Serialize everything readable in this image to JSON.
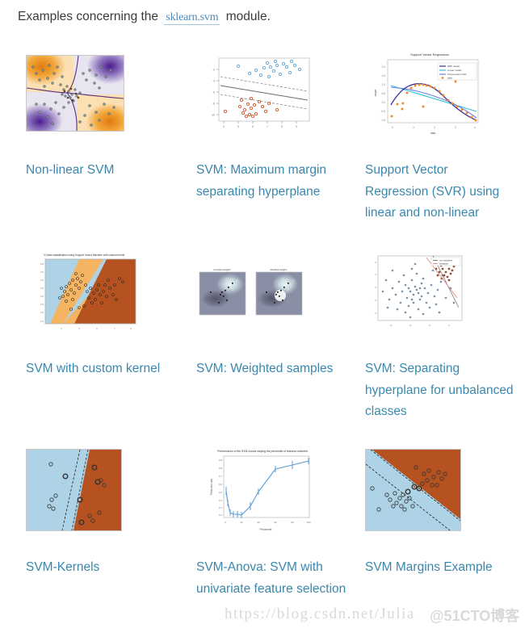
{
  "intro": {
    "before": "Examples concerning the",
    "module": "sklearn.svm",
    "after": "module."
  },
  "gallery": {
    "rows": [
      [
        {
          "caption": "Non-linear SVM",
          "thumb_name": "thumb-non-linear-svm",
          "thumb_kind": "decision-surface"
        },
        {
          "caption": "SVM: Maximum margin separating hyperplane",
          "thumb_name": "thumb-max-margin-hyperplane",
          "thumb_kind": "scatter-with-margins"
        },
        {
          "caption": "Support Vector Regression (SVR) using linear and non-linear kernels",
          "thumb_name": "thumb-support-vector-regression",
          "thumb_kind": "line-chart"
        }
      ],
      [
        {
          "caption": "SVM with custom kernel",
          "thumb_name": "thumb-svm-custom-kernel",
          "thumb_kind": "decision-regions"
        },
        {
          "caption": "SVM: Weighted samples",
          "thumb_name": "thumb-svm-weighted-samples",
          "thumb_kind": "dual-contour"
        },
        {
          "caption": "SVM: Separating hyperplane for unbalanced classes",
          "thumb_name": "thumb-svm-unbalanced-classes",
          "thumb_kind": "scatter-cluster"
        }
      ],
      [
        {
          "caption": "SVM-Kernels",
          "thumb_name": "thumb-svm-kernels",
          "thumb_kind": "decision-regions"
        },
        {
          "caption": "SVM-Anova: SVM with univariate feature selection",
          "thumb_name": "thumb-svm-anova",
          "thumb_kind": "line-chart"
        },
        {
          "caption": "SVM Margins Example",
          "thumb_name": "thumb-svm-margins-example",
          "thumb_kind": "decision-regions"
        }
      ]
    ]
  },
  "thumbnails": {
    "svr": {
      "title": "Support Vector Regression",
      "xlabel": "data",
      "ylabel": "target",
      "legend": [
        "RBF model",
        "Linear model",
        "Polynomial model",
        "data"
      ],
      "xticks": [
        "0",
        "1",
        "2",
        "3",
        "4"
      ],
      "yticks": [
        "-1.5",
        "-1.0",
        "-0.5",
        "0.0",
        "0.5",
        "1.0",
        "1.5",
        "2.0"
      ]
    },
    "custom_kernel": {
      "title": "3-Class classification using Support Vector Machine with custom kernel",
      "xticks": [
        "4",
        "5",
        "6",
        "7",
        "8"
      ],
      "yticks": [
        "2.0",
        "2.5",
        "3.0",
        "3.5",
        "4.0",
        "4.5",
        "5.0"
      ]
    },
    "weighted_samples": {
      "panel_titles": [
        "Constant weights",
        "Modified weights"
      ]
    },
    "unbalanced": {
      "legend": [
        "non weighted",
        "weighted"
      ],
      "xticks": [
        "-4",
        "-2",
        "0",
        "2"
      ],
      "yticks": [
        "-4",
        "-2",
        "0",
        "2",
        "4"
      ]
    },
    "anova": {
      "title": "Performance of the SVM-Anova varying the percentile of features selected",
      "xlabel": "Percentile",
      "ylabel": "Prediction rate",
      "xticks": [
        "0",
        "20",
        "40",
        "60",
        "80",
        "100"
      ],
      "yticks": [
        "0.2",
        "0.3",
        "0.4",
        "0.5",
        "0.6",
        "0.7",
        "0.8",
        "0.9"
      ]
    },
    "max_margin": {
      "xticks": [
        "4",
        "5",
        "6",
        "7",
        "8",
        "9",
        "10"
      ],
      "yticks": [
        "-2",
        "-4",
        "-6",
        "-8",
        "-10"
      ]
    }
  },
  "chart_data": [
    {
      "type": "line",
      "name": "support-vector-regression",
      "title": "Support Vector Regression",
      "xlabel": "data",
      "ylabel": "target",
      "xlim": [
        0,
        4.6
      ],
      "ylim": [
        -1.6,
        2.2
      ],
      "legend_position": "top-right",
      "grid": false,
      "series": [
        {
          "name": "RBF model",
          "color": "#4b3f9e",
          "x": [
            0.0,
            0.5,
            1.0,
            1.5,
            2.0,
            2.5,
            3.0,
            3.5,
            4.0,
            4.5
          ],
          "values": [
            -0.6,
            0.25,
            0.82,
            1.0,
            0.97,
            0.72,
            0.3,
            -0.25,
            -0.85,
            -1.4
          ]
        },
        {
          "name": "Linear model",
          "color": "#2ec5d9",
          "x": [
            0.0,
            4.5
          ],
          "values": [
            1.0,
            -0.75
          ]
        },
        {
          "name": "Polynomial model",
          "color": "#6a7fe0",
          "x": [
            0.0,
            1.0,
            2.0,
            3.0,
            4.0,
            4.5
          ],
          "values": [
            0.92,
            0.88,
            0.72,
            0.34,
            -0.35,
            -1.2
          ]
        },
        {
          "name": "data",
          "color": "#f08a2c",
          "x": [
            0.05,
            0.3,
            0.55,
            0.8,
            1.05,
            1.3,
            1.55,
            1.8,
            2.05,
            2.3,
            2.55,
            2.8,
            3.05,
            3.3,
            3.55,
            3.8,
            4.05,
            4.4
          ],
          "values": [
            -1.25,
            0.25,
            0.3,
            0.85,
            0.9,
            0.95,
            1.0,
            2.05,
            0.95,
            0.75,
            1.15,
            0.35,
            0.1,
            -0.3,
            -0.55,
            -0.75,
            -1.1,
            -1.45
          ]
        }
      ]
    },
    {
      "type": "line",
      "name": "svm-anova",
      "title": "Performance of the SVM-Anova varying the percentile of features selected",
      "xlabel": "Percentile",
      "ylabel": "Prediction rate",
      "xlim": [
        0,
        105
      ],
      "ylim": [
        0.15,
        0.95
      ],
      "grid": false,
      "color": "#5b9bd5",
      "x": [
        1,
        3,
        6,
        10,
        15,
        20,
        30,
        40,
        60,
        80,
        100
      ],
      "values": [
        0.55,
        0.38,
        0.25,
        0.23,
        0.23,
        0.22,
        0.32,
        0.55,
        0.8,
        0.86,
        0.9
      ],
      "errors": [
        0.05,
        0.04,
        0.03,
        0.02,
        0.02,
        0.03,
        0.05,
        0.04,
        0.03,
        0.04,
        0.03
      ]
    }
  ],
  "watermark": {
    "url": "https://blog.csdn.net/Julia",
    "logo": "@51CTO博客"
  }
}
